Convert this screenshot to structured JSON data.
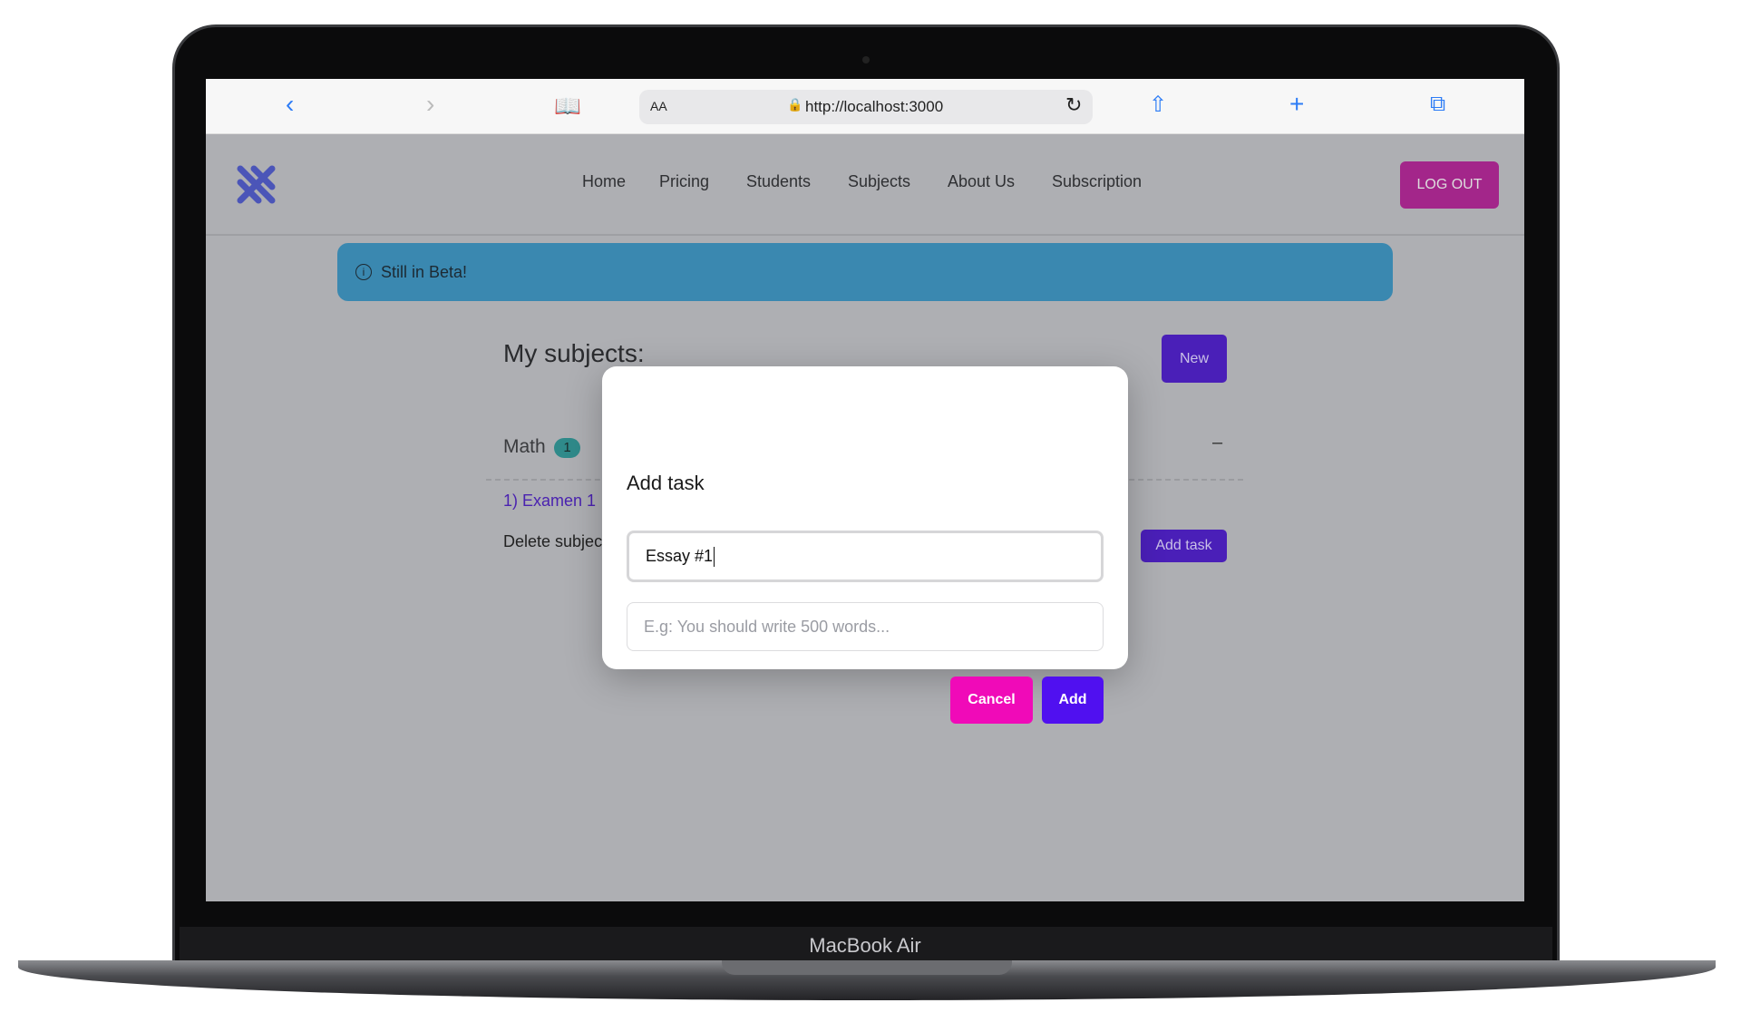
{
  "device": {
    "label": "MacBook Air"
  },
  "browser": {
    "url": "http://localhost:3000",
    "text_size_label": "AA"
  },
  "nav": {
    "items": [
      "Home",
      "Pricing",
      "Students",
      "Subjects",
      "About Us",
      "Subscription"
    ],
    "logout": "LOG OUT"
  },
  "banner": {
    "text": "Still in Beta!"
  },
  "subjects": {
    "title": "My subjects:",
    "new_label": "New",
    "items": [
      {
        "name": "Math",
        "count": "1",
        "tasks": [
          "1) Examen 1"
        ],
        "delete_label": "Delete subject",
        "add_task_label": "Add task",
        "collapse": "–"
      }
    ]
  },
  "modal": {
    "title": "Add task",
    "name_value": "Essay #1",
    "desc_placeholder": "E.g: You should write 500 words...",
    "cancel": "Cancel",
    "add": "Add"
  },
  "colors": {
    "logout": "#a3268a",
    "banner": "#3a88b0",
    "primary": "#5010f0",
    "cancel": "#f00ab8"
  }
}
